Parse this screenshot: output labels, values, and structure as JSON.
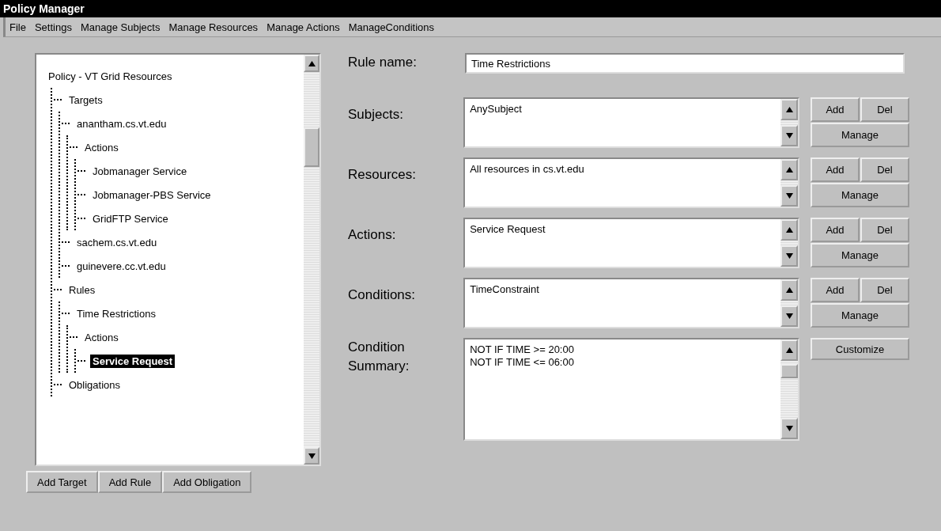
{
  "window": {
    "title": "Policy Manager"
  },
  "menu": [
    "File",
    "Settings",
    "Manage Subjects",
    "Manage Resources",
    "Manage Actions",
    "ManageConditions"
  ],
  "tree": {
    "label": "Policy - VT Grid Resources",
    "selected": false,
    "children": [
      {
        "label": "Targets",
        "selected": false,
        "children": [
          {
            "label": "anantham.cs.vt.edu",
            "selected": false,
            "children": [
              {
                "label": "Actions",
                "selected": false,
                "children": [
                  {
                    "label": "Jobmanager Service",
                    "selected": false
                  },
                  {
                    "label": "Jobmanager-PBS Service",
                    "selected": false
                  },
                  {
                    "label": "GridFTP Service",
                    "selected": false
                  }
                ]
              }
            ]
          },
          {
            "label": "sachem.cs.vt.edu",
            "selected": false
          },
          {
            "label": "guinevere.cc.vt.edu",
            "selected": false
          }
        ]
      },
      {
        "label": "Rules",
        "selected": false,
        "children": [
          {
            "label": "Time Restrictions",
            "selected": false,
            "children": [
              {
                "label": "Actions",
                "selected": false,
                "children": [
                  {
                    "label": "Service Request",
                    "selected": true
                  }
                ]
              }
            ]
          }
        ]
      },
      {
        "label": "Obligations",
        "selected": false
      }
    ]
  },
  "tree_buttons": [
    "Add Target",
    "Add Rule",
    "Add Obligation"
  ],
  "rule_name": {
    "label": "Rule name:",
    "value": "Time Restrictions"
  },
  "lists": [
    {
      "label": "Subjects:",
      "lines": [
        "AnySubject"
      ],
      "buttons": [
        "Add",
        "Del",
        "Manage"
      ]
    },
    {
      "label": "Resources:",
      "lines": [
        "All resources in cs.vt.edu"
      ],
      "buttons": [
        "Add",
        "Del",
        "Manage"
      ]
    },
    {
      "label": "Actions:",
      "lines": [
        "Service Request"
      ],
      "buttons": [
        "Add",
        "Del",
        "Manage"
      ]
    },
    {
      "label": "Conditions:",
      "lines": [
        "TimeConstraint"
      ],
      "buttons": [
        "Add",
        "Del",
        "Manage"
      ]
    }
  ],
  "summary": {
    "label_lines": [
      "Condition",
      "Summary:"
    ],
    "lines": [
      "NOT IF TIME >= 20:00",
      "NOT IF TIME <= 06:00"
    ],
    "button": "Customize"
  }
}
